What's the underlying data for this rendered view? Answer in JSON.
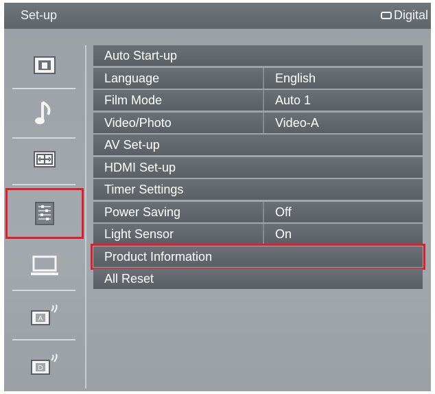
{
  "header": {
    "title": "Set-up",
    "source_label": "Digital",
    "source_icon": "screen-outline-icon"
  },
  "sidebar": {
    "items": [
      {
        "icon": "picture-icon",
        "selected": false
      },
      {
        "icon": "music-note-icon",
        "selected": false
      },
      {
        "icon": "screen-adjust-icon",
        "selected": false
      },
      {
        "icon": "settings-icon",
        "selected": true
      },
      {
        "icon": "pc-icon",
        "selected": false
      },
      {
        "icon": "analog-antenna-icon",
        "selected": false
      },
      {
        "icon": "digital-antenna-icon",
        "selected": false
      }
    ]
  },
  "menu": {
    "items": [
      {
        "label": "Auto Start-up",
        "value": ""
      },
      {
        "label": "Language",
        "value": "English"
      },
      {
        "label": "Film Mode",
        "value": "Auto 1"
      },
      {
        "label": "Video/Photo",
        "value": "Video-A"
      },
      {
        "label": "AV Set-up",
        "value": ""
      },
      {
        "label": "HDMI Set-up",
        "value": ""
      },
      {
        "label": "Timer Settings",
        "value": ""
      },
      {
        "label": "Power Saving",
        "value": "Off"
      },
      {
        "label": "Light Sensor",
        "value": "On"
      },
      {
        "label": "Product Information",
        "value": "",
        "selected": true
      },
      {
        "label": "All Reset",
        "value": ""
      }
    ]
  },
  "colors": {
    "highlight": "#e01e2a",
    "row_bg": "#5e646a",
    "panel_bg": "#a0a6ab"
  }
}
